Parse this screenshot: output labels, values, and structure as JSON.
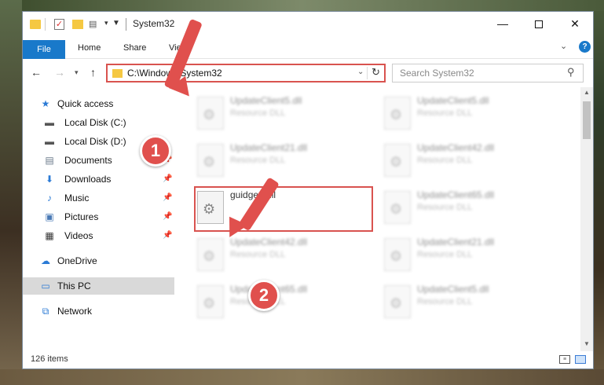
{
  "window": {
    "title": "System32",
    "controls": {
      "minimize": "—",
      "close": "✕"
    }
  },
  "ribbon": {
    "tabs": {
      "file": "File",
      "home": "Home",
      "share": "Share",
      "view": "View"
    },
    "help": "?"
  },
  "navigation": {
    "address": "C:\\Windows\\System32",
    "search_placeholder": "Search System32"
  },
  "sidebar": {
    "items": [
      {
        "label": "Quick access",
        "icon": "star-icon"
      },
      {
        "label": "Local Disk (C:)",
        "icon": "drive-icon"
      },
      {
        "label": "Local Disk (D:)",
        "icon": "drive-icon"
      },
      {
        "label": "Documents",
        "icon": "documents-icon",
        "pinned": true
      },
      {
        "label": "Downloads",
        "icon": "downloads-icon",
        "pinned": true
      },
      {
        "label": "Music",
        "icon": "music-icon",
        "pinned": true
      },
      {
        "label": "Pictures",
        "icon": "pictures-icon",
        "pinned": true
      },
      {
        "label": "Videos",
        "icon": "videos-icon",
        "pinned": true
      },
      {
        "label": "OneDrive",
        "icon": "cloud-icon"
      },
      {
        "label": "This PC",
        "icon": "computer-icon",
        "selected": true
      },
      {
        "label": "Network",
        "icon": "network-icon"
      }
    ]
  },
  "files": {
    "left": [
      {
        "name": "UpdateClient5.dll",
        "type": "Resource DLL"
      },
      {
        "name": "UpdateClient21.dll",
        "type": "Resource DLL"
      },
      {
        "name": "guidgen.dll",
        "type": ""
      },
      {
        "name": "UpdateClient42.dll",
        "type": "Resource DLL"
      },
      {
        "name": "UpdateClient65.dll",
        "type": "Resource DLL"
      }
    ],
    "right": [
      {
        "name": "UpdateClient5.dll",
        "type": "Resource DLL"
      },
      {
        "name": "UpdateClient42.dll",
        "type": "Resource DLL"
      },
      {
        "name": "UpdateClient65.dll",
        "type": "Resource DLL"
      },
      {
        "name": "UpdateClient21.dll",
        "type": "Resource DLL"
      },
      {
        "name": "UpdateClient5.dll",
        "type": "Resource DLL"
      }
    ]
  },
  "status": {
    "count": "126 items"
  },
  "annotations": {
    "step1": "1",
    "step2": "2",
    "color": "#e0504d"
  }
}
